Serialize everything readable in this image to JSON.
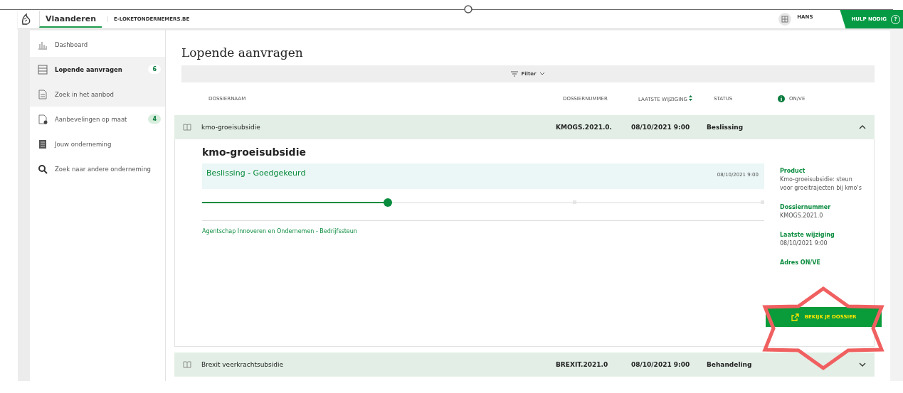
{
  "header": {
    "brand": "Vlaanderen",
    "site": "E-LOKETONDERNEMERS.BE",
    "user": "HANS",
    "help": "HULP NODIG",
    "help_icon": "?"
  },
  "sidebar": {
    "items": [
      {
        "label": "Dashboard",
        "selected": false,
        "hovered": false
      },
      {
        "label": "Lopende aanvragen",
        "selected": true,
        "hovered": false,
        "badge": "6"
      },
      {
        "label": "Zoek in het aanbod",
        "selected": false,
        "hovered": true
      },
      {
        "label": "Aanbevelingen op maat",
        "selected": false,
        "hovered": false,
        "badge": "4"
      },
      {
        "label": "Jouw onderneming",
        "selected": false,
        "hovered": false
      },
      {
        "label": "Zoek naar andere onderneming",
        "selected": false,
        "hovered": false
      }
    ]
  },
  "page_title": "Lopende aanvragen",
  "filter": "Filter",
  "table": {
    "columns": [
      "DOSSIERNAAM",
      "DOSSIERNUMMER",
      "LAATSTE WIJZIGING",
      "STATUS",
      "ON/VE"
    ],
    "rows": [
      {
        "name": "kmo-groeisubsidie",
        "number": "KMOGS.2021.0.",
        "changed": "08/10/2021 9:00",
        "status": "Beslissing",
        "expanded": true
      },
      {
        "name": "Brexit veerkrachtsubsidie",
        "number": "BREXIT.2021.0",
        "changed": "08/10/2021 9:00",
        "status": "Behandeling",
        "expanded": false
      }
    ]
  },
  "detail": {
    "title": "kmo-groeisubsidie",
    "step_title": "Beslissing - Goedgekeurd",
    "step_date": "08/10/2021 9:00",
    "level": 0.33,
    "agency": "Agentschap Innoveren en Ondernemen - Bedrijfssteun",
    "facts": [
      {
        "label": "Product",
        "value": "Kmo-groeisubsidie: steun voor groeitrajecten bij kmo's"
      },
      {
        "label": "Dossiernummer",
        "value": "KMOGS.2021.0"
      },
      {
        "label": "Laatste wijziging",
        "value": "08/10/2021 9:00"
      },
      {
        "label": "Adres ON/VE"
      }
    ],
    "button": "BEKIJK JE DOSSIER"
  }
}
